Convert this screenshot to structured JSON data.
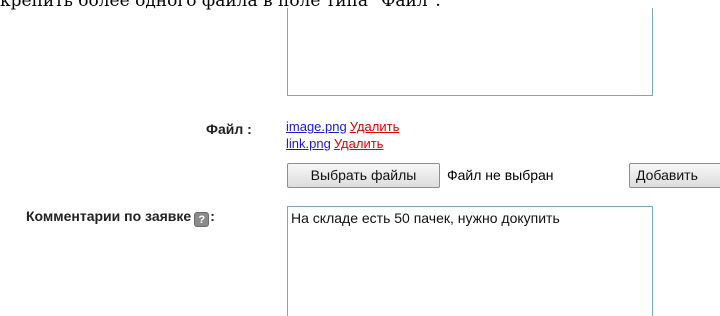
{
  "top_note": "крепить более одного файла в поле типа \"Файл\".",
  "file_section": {
    "label": "Файл :",
    "files": [
      {
        "name": "image.png",
        "delete_label": "Удалить"
      },
      {
        "name": "link.png",
        "delete_label": "Удалить"
      }
    ],
    "choose_button_label": "Выбрать файлы",
    "no_file_text": "Файл не выбран",
    "add_button_label": "Добавить"
  },
  "comment_section": {
    "label": "Комментарии по заявке",
    "help_icon_glyph": "?",
    "label_suffix": ":",
    "value": "На складе есть 50 пачек, нужно докупить"
  },
  "colors": {
    "file_link": "#1a1ad6",
    "delete_link": "#e00000",
    "field_border": "#7fa7be"
  }
}
